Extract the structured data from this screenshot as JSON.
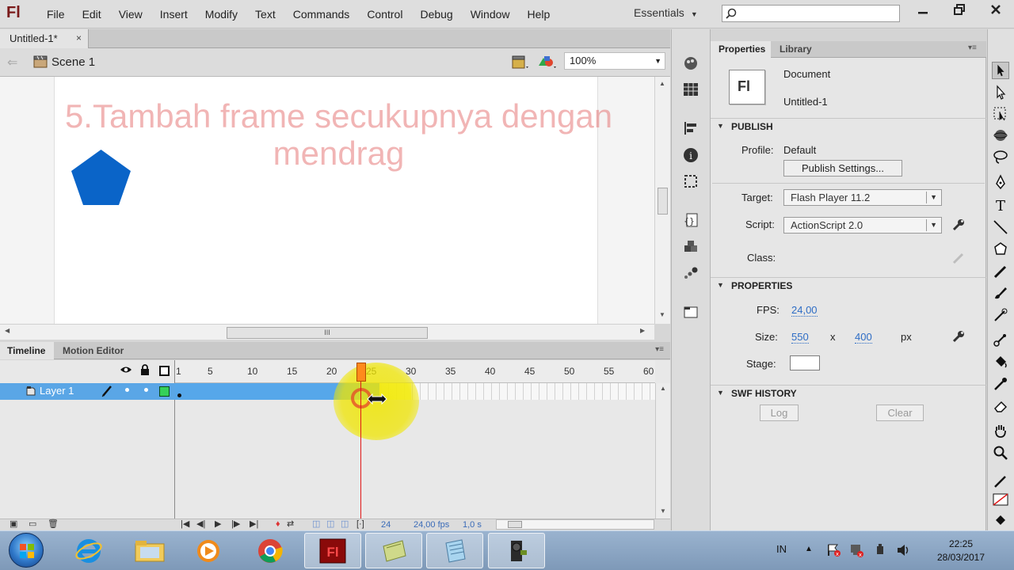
{
  "app": {
    "logo": "Fl",
    "menus": [
      "File",
      "Edit",
      "View",
      "Insert",
      "Modify",
      "Text",
      "Commands",
      "Control",
      "Debug",
      "Window",
      "Help"
    ],
    "workspace": "Essentials",
    "search": {
      "value": "",
      "placeholder": ""
    },
    "window_controls": [
      "minimize-icon",
      "restore-icon",
      "close-icon"
    ]
  },
  "document": {
    "tab_label": "Untitled-1*",
    "close_glyph": "×",
    "scene_label": "Scene 1",
    "zoom": "100%",
    "stage_caption_line1": "5.Tambah frame secukupnya dengan",
    "stage_caption_line2": "mendrag",
    "shape_color": "#0a64c8",
    "hscroll_grip": "III"
  },
  "timeline": {
    "tabs": [
      "Timeline",
      "Motion Editor"
    ],
    "ruler_labels": [
      "1",
      "5",
      "10",
      "15",
      "20",
      "25",
      "30",
      "35",
      "40",
      "45",
      "50",
      "55",
      "60"
    ],
    "layer_name": "Layer 1",
    "layer_color": "#35d05a",
    "current_frame": "24",
    "fps_display": "24,00 fps",
    "elapsed": "1,0 s",
    "total_frames_visible": 60,
    "filled_frames": 25
  },
  "properties": {
    "tabs": [
      "Properties",
      "Library"
    ],
    "doc_icon": "Fl",
    "doc_type": "Document",
    "doc_name": "Untitled-1",
    "publish": {
      "heading": "PUBLISH",
      "profile_label": "Profile:",
      "profile_value": "Default",
      "publish_settings_button": "Publish Settings...",
      "target_label": "Target:",
      "target_value": "Flash Player 11.2",
      "script_label": "Script:",
      "script_value": "ActionScript 2.0",
      "class_label": "Class:"
    },
    "props": {
      "heading": "PROPERTIES",
      "fps_label": "FPS:",
      "fps_value": "24,00",
      "size_label": "Size:",
      "width": "550",
      "x_sep": "x",
      "height": "400",
      "unit": "px",
      "stage_label": "Stage:",
      "stage_color": "#ffffff"
    },
    "swf_history": {
      "heading": "SWF HISTORY",
      "log_button": "Log",
      "clear_button": "Clear"
    }
  },
  "taskbar": {
    "apps": [
      "internet-explorer-icon",
      "file-explorer-icon",
      "media-player-icon",
      "chrome-icon",
      "flash-icon",
      "app-icon",
      "notepad-icon",
      "camera-app-icon"
    ],
    "language": "IN",
    "time": "22:25",
    "date": "28/03/2017"
  }
}
